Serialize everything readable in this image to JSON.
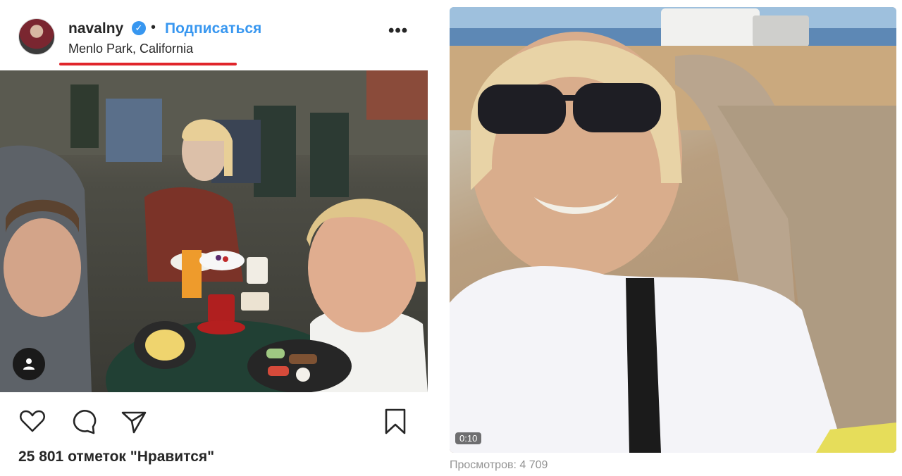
{
  "header": {
    "username": "navalny",
    "verified_icon": "check-icon",
    "separator": "•",
    "follow_label": "Подписаться",
    "more_label": "•••",
    "location": "Menlo Park, California"
  },
  "photo": {
    "user_tag_icon": "person-icon"
  },
  "actions": {
    "icons": [
      "heart-icon",
      "comment-icon",
      "share-icon",
      "bookmark-icon"
    ]
  },
  "likes_text": "25 801 отметок \"Нравится\"",
  "video": {
    "duration": "0:10",
    "views_text": "Просмотров: 4 709"
  },
  "colors": {
    "accent": "#3897f0",
    "highlight_line": "#e0252b",
    "text": "#262626",
    "muted": "#939393"
  }
}
